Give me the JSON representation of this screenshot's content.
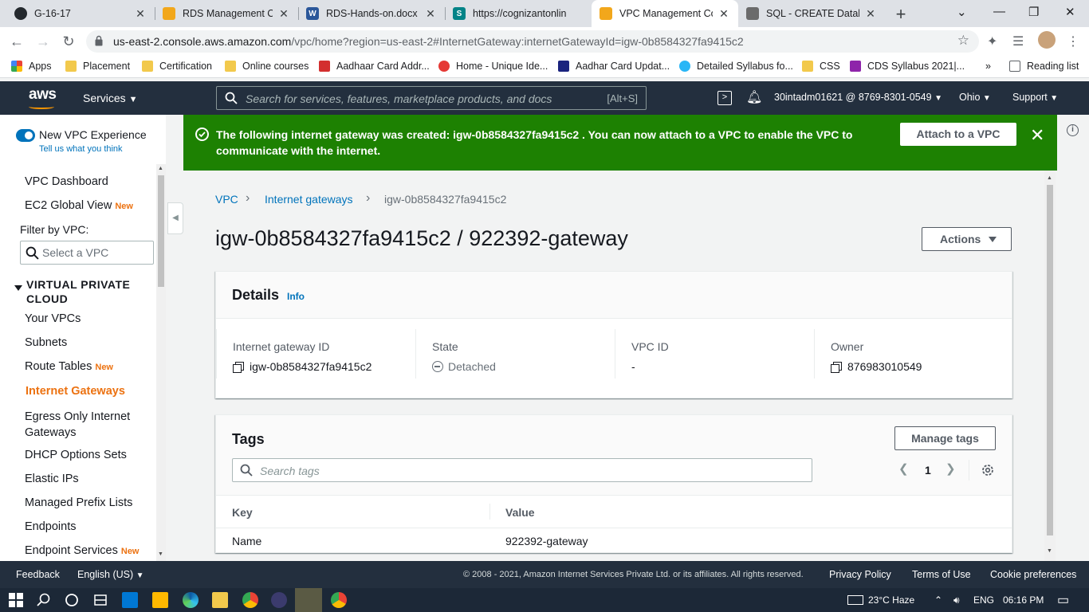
{
  "browser": {
    "tabs": [
      {
        "title": "G-16-17"
      },
      {
        "title": "RDS Management Con"
      },
      {
        "title": "RDS-Hands-on.docx"
      },
      {
        "title": "https://cognizantonlin"
      },
      {
        "title": "VPC Management Con"
      },
      {
        "title": "SQL - CREATE Databas"
      }
    ],
    "url_host": "us-east-2.console.aws.amazon.com",
    "url_path": "/vpc/home?region=us-east-2#InternetGateway:internetGatewayId=igw-0b8584327fa9415c2",
    "bookmarks": [
      "Apps",
      "Placement",
      "Certification",
      "Online courses",
      "Aadhaar Card Addr...",
      "Home - Unique Ide...",
      "Aadhar Card Updat...",
      "Detailed Syllabus fo...",
      "CSS",
      "CDS Syllabus 2021|..."
    ],
    "reading_list": "Reading list",
    "overflow": "»"
  },
  "aws": {
    "logo": "aws",
    "services": "Services",
    "search_placeholder": "Search for services, features, marketplace products, and docs",
    "search_shortcut": "[Alt+S]",
    "account": "30intadm01621 @ 8769-8301-0549",
    "region": "Ohio",
    "support": "Support"
  },
  "sidebar": {
    "toggle_label": "New VPC Experience",
    "tell_us": "Tell us what you think",
    "dashboard": "VPC Dashboard",
    "ec2_global": "EC2 Global View",
    "new_badge": "New",
    "filter_label": "Filter by VPC:",
    "filter_placeholder": "Select a VPC",
    "section": "VIRTUAL PRIVATE CLOUD",
    "items": [
      {
        "label": "Your VPCs",
        "badge": ""
      },
      {
        "label": "Subnets",
        "badge": ""
      },
      {
        "label": "Route Tables",
        "badge": "New"
      },
      {
        "label": "Internet Gateways",
        "badge": ""
      },
      {
        "label": "Egress Only Internet Gateways",
        "badge": ""
      },
      {
        "label": "DHCP Options Sets",
        "badge": ""
      },
      {
        "label": "Elastic IPs",
        "badge": ""
      },
      {
        "label": "Managed Prefix Lists",
        "badge": ""
      },
      {
        "label": "Endpoints",
        "badge": ""
      },
      {
        "label": "Endpoint Services",
        "badge": "New"
      }
    ]
  },
  "banner": {
    "message": "The following internet gateway was created: igw-0b8584327fa9415c2 . You can now attach to a VPC to enable the VPC to communicate with the internet.",
    "attach_button": "Attach to a VPC",
    "color": "#1d8102"
  },
  "breadcrumb": {
    "root": "VPC",
    "section": "Internet gateways",
    "current": "igw-0b8584327fa9415c2"
  },
  "page": {
    "title": "igw-0b8584327fa9415c2 / 922392-gateway",
    "actions": "Actions"
  },
  "details": {
    "title": "Details",
    "info": "Info",
    "fields": [
      {
        "label": "Internet gateway ID",
        "value": "igw-0b8584327fa9415c2"
      },
      {
        "label": "State",
        "value": "Detached"
      },
      {
        "label": "VPC ID",
        "value": "-"
      },
      {
        "label": "Owner",
        "value": "876983010549"
      }
    ]
  },
  "tags": {
    "title": "Tags",
    "manage": "Manage tags",
    "search_placeholder": "Search tags",
    "page": "1",
    "columns": [
      "Key",
      "Value"
    ],
    "rows": [
      {
        "key": "Name",
        "value": "922392-gateway"
      }
    ]
  },
  "footer": {
    "feedback": "Feedback",
    "language": "English (US)",
    "copyright": "© 2008 - 2021, Amazon Internet Services Private Ltd. or its affiliates. All rights reserved.",
    "privacy": "Privacy Policy",
    "terms": "Terms of Use",
    "cookies": "Cookie preferences"
  },
  "taskbar": {
    "weather": "23°C  Haze",
    "lang": "ENG",
    "time": "06:16 PM"
  },
  "colors": {
    "aws_nav": "#232f3e",
    "accent_orange": "#ec7211",
    "link_blue": "#0073bb"
  }
}
